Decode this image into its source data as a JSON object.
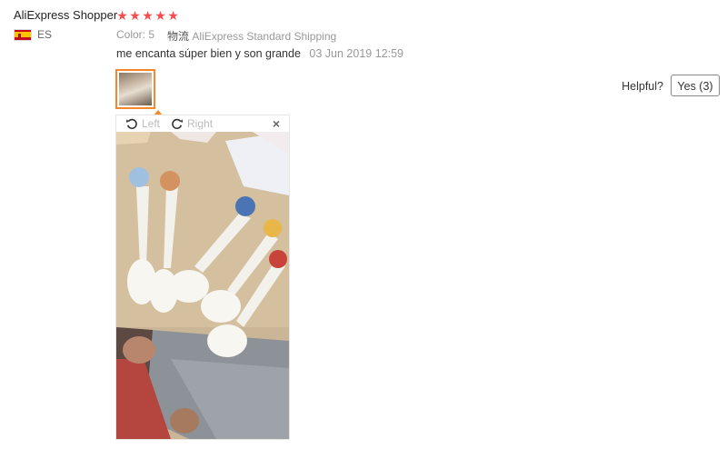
{
  "review": {
    "reviewer": "AliExpress Shopper",
    "rating": 5,
    "country_code": "ES",
    "color_label": "Color:",
    "color_value": "5",
    "shipping_label": "物流",
    "shipping_value": "AliExpress Standard Shipping",
    "comment": "me encanta súper bien y son grande",
    "date": "03 Jun 2019 12:59"
  },
  "helpful": {
    "label": "Helpful?",
    "yes_button": "Yes (3)"
  },
  "viewer": {
    "rotate_left": "Left",
    "rotate_right": "Right",
    "close": "×"
  },
  "colors": {
    "star": "#f44d4d",
    "accent": "#f6872b",
    "muted": "#999999"
  },
  "icons": [
    "star-icon",
    "spain-flag-icon",
    "rotate-left-icon",
    "rotate-right-icon",
    "close-icon"
  ]
}
